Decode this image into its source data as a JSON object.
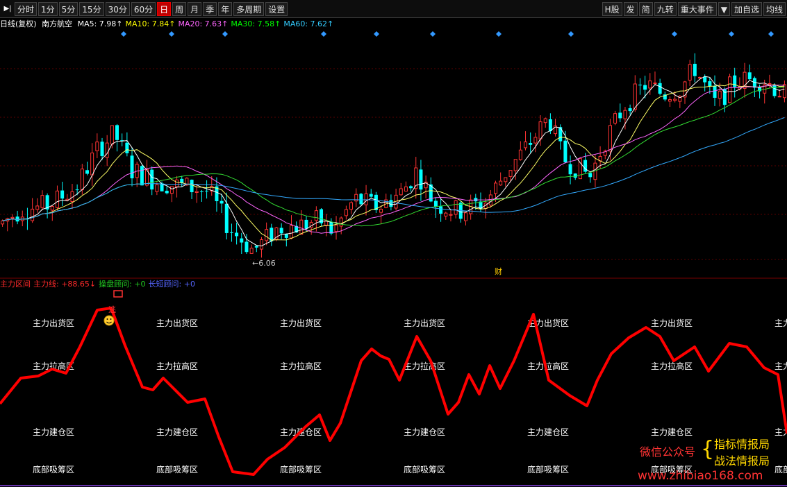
{
  "toolbar": {
    "periods": [
      "分时",
      "1分",
      "5分",
      "15分",
      "30分",
      "60分",
      "日",
      "周",
      "月",
      "季",
      "年",
      "多周期",
      "设置"
    ],
    "active_period": "日",
    "right_buttons": [
      "H股",
      "发",
      "简",
      "九转",
      "重大事件",
      "▼",
      "加自选",
      "均线"
    ],
    "play_icon": "play-back-icon"
  },
  "info": {
    "period_label": "日线(复权)",
    "stock_name": "南方航空",
    "ma": [
      {
        "label": "MA5: 7.98↑",
        "color": "#ffffff"
      },
      {
        "label": "MA10: 7.84↑",
        "color": "#ffff00"
      },
      {
        "label": "MA20: 7.63↑",
        "color": "#ff66ff"
      },
      {
        "label": "MA30: 7.58↑",
        "color": "#00ff00"
      },
      {
        "label": "MA60: 7.62↑",
        "color": "#33ccff"
      }
    ]
  },
  "colors": {
    "up": "#ff3333",
    "down": "#00ffff",
    "grid": "#5a0000",
    "sub_line": "#ff0000",
    "ma5": "#ffffff",
    "ma10": "#ffff66",
    "ma20": "#ff66ff",
    "ma30": "#33dd33",
    "ma60": "#33aaff"
  },
  "chart_data": {
    "type": "candlestick",
    "low_label": "←6.06",
    "event_marker": "财",
    "diamond_markers": [
      178,
      247,
      324,
      466,
      542,
      623,
      718,
      822,
      971,
      1053,
      1110
    ],
    "control_points": [
      [
        0,
        7.0
      ],
      [
        30,
        7.35
      ],
      [
        70,
        7.45
      ],
      [
        110,
        7.9
      ],
      [
        140,
        8.8
      ],
      [
        165,
        9.2
      ],
      [
        190,
        8.3
      ],
      [
        230,
        8.0
      ],
      [
        270,
        7.9
      ],
      [
        300,
        7.8
      ],
      [
        330,
        6.9
      ],
      [
        365,
        6.35
      ],
      [
        400,
        6.9
      ],
      [
        430,
        6.95
      ],
      [
        460,
        7.1
      ],
      [
        480,
        6.8
      ],
      [
        510,
        7.6
      ],
      [
        545,
        7.4
      ],
      [
        580,
        7.8
      ],
      [
        600,
        8.3
      ],
      [
        625,
        7.5
      ],
      [
        660,
        7.3
      ],
      [
        700,
        7.55
      ],
      [
        730,
        8.3
      ],
      [
        760,
        8.9
      ],
      [
        790,
        9.6
      ],
      [
        810,
        8.6
      ],
      [
        850,
        8.15
      ],
      [
        870,
        9.0
      ],
      [
        900,
        9.9
      ],
      [
        930,
        10.4
      ],
      [
        955,
        10.15
      ],
      [
        980,
        10.3
      ],
      [
        1000,
        10.8
      ],
      [
        1030,
        9.9
      ],
      [
        1060,
        10.5
      ],
      [
        1100,
        10.5
      ],
      [
        1133,
        10.1
      ]
    ]
  },
  "sub": {
    "labels": [
      {
        "text": "主力区间",
        "color": "#ff2a2a"
      },
      {
        "text": "主力线: +88.65↓",
        "color": "#ff2a2a"
      },
      {
        "text": "操盘顾问: +0",
        "color": "#22cc22"
      },
      {
        "text": "长短顾问: +0",
        "color": "#5566ff"
      }
    ],
    "zones": [
      "主力出货区",
      "主力拉高区",
      "主力建仓区",
      "底部吸筹区"
    ],
    "zone_columns": [
      47,
      225,
      403,
      581,
      759,
      937,
      1115
    ],
    "signal_char": "逃",
    "smiley": "smiley-icon",
    "curve": [
      [
        0,
        582
      ],
      [
        30,
        545
      ],
      [
        55,
        542
      ],
      [
        75,
        532
      ],
      [
        95,
        538
      ],
      [
        115,
        500
      ],
      [
        140,
        447
      ],
      [
        160,
        444
      ],
      [
        180,
        498
      ],
      [
        205,
        558
      ],
      [
        220,
        562
      ],
      [
        235,
        545
      ],
      [
        250,
        560
      ],
      [
        270,
        580
      ],
      [
        295,
        575
      ],
      [
        315,
        630
      ],
      [
        335,
        680
      ],
      [
        365,
        684
      ],
      [
        385,
        662
      ],
      [
        410,
        645
      ],
      [
        440,
        615
      ],
      [
        460,
        598
      ],
      [
        475,
        635
      ],
      [
        490,
        610
      ],
      [
        520,
        520
      ],
      [
        535,
        503
      ],
      [
        548,
        513
      ],
      [
        560,
        518
      ],
      [
        575,
        548
      ],
      [
        600,
        485
      ],
      [
        620,
        520
      ],
      [
        645,
        597
      ],
      [
        660,
        580
      ],
      [
        675,
        540
      ],
      [
        690,
        568
      ],
      [
        705,
        527
      ],
      [
        720,
        560
      ],
      [
        740,
        520
      ],
      [
        768,
        453
      ],
      [
        790,
        548
      ],
      [
        820,
        570
      ],
      [
        845,
        585
      ],
      [
        860,
        548
      ],
      [
        880,
        510
      ],
      [
        905,
        487
      ],
      [
        930,
        472
      ],
      [
        950,
        485
      ],
      [
        970,
        520
      ],
      [
        1000,
        500
      ],
      [
        1020,
        535
      ],
      [
        1050,
        495
      ],
      [
        1075,
        500
      ],
      [
        1100,
        530
      ],
      [
        1120,
        540
      ],
      [
        1133,
        625
      ]
    ]
  },
  "watermark": {
    "wechat_label": "微信公众号",
    "brace": "{",
    "names": [
      "指标情报局",
      "战法情报局"
    ],
    "url": "www.zhibiao168.com"
  }
}
